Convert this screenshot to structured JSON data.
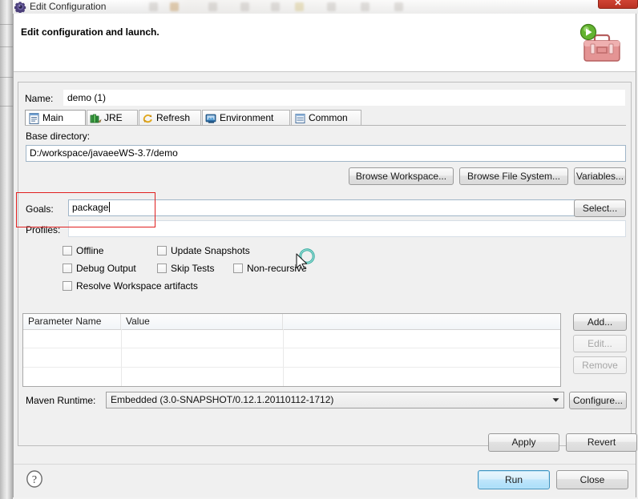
{
  "window": {
    "title": "Edit Configuration",
    "title_icon": "gear-icon",
    "close_label": "✕"
  },
  "header": {
    "title": "Edit configuration and launch.",
    "icon": "maven-launch-toolbox-icon"
  },
  "form": {
    "name_label": "Name:",
    "name_value": "demo (1)"
  },
  "tabs": [
    {
      "label": "Main",
      "icon": "document-icon",
      "selected": true
    },
    {
      "label": "JRE",
      "icon": "books-icon",
      "selected": false
    },
    {
      "label": "Refresh",
      "icon": "refresh-icon",
      "selected": false
    },
    {
      "label": "Environment",
      "icon": "environment-icon",
      "selected": false
    },
    {
      "label": "Common",
      "icon": "common-list-icon",
      "selected": false
    }
  ],
  "main_tab": {
    "base_directory_label": "Base directory:",
    "base_directory_value": "D:/workspace/javaeeWS-3.7/demo",
    "browse_workspace_label": "Browse Workspace...",
    "browse_filesystem_label": "Browse File System...",
    "variables_label": "Variables...",
    "goals_label": "Goals:",
    "goals_value": "package",
    "goals_select_label": "Select...",
    "profiles_label": "Profiles:",
    "profiles_value": "",
    "checkboxes": [
      {
        "label": "Offline",
        "checked": false
      },
      {
        "label": "Update Snapshots",
        "checked": false
      },
      {
        "label": "Debug Output",
        "checked": false
      },
      {
        "label": "Skip Tests",
        "checked": false
      },
      {
        "label": "Non-recursive",
        "checked": false
      },
      {
        "label": "Resolve Workspace artifacts",
        "checked": false
      }
    ],
    "table": {
      "columns": [
        "Parameter Name",
        "Value"
      ],
      "rows": [],
      "empty_row_count": 3
    },
    "table_buttons": [
      {
        "label": "Add...",
        "enabled": true
      },
      {
        "label": "Edit...",
        "enabled": false
      },
      {
        "label": "Remove",
        "enabled": false
      }
    ],
    "maven_runtime_label": "Maven Runtime:",
    "maven_runtime_value": "Embedded (3.0-SNAPSHOT/0.12.1.20110112-1712)",
    "configure_label": "Configure..."
  },
  "actions": {
    "apply_label": "Apply",
    "revert_label": "Revert"
  },
  "footer": {
    "help_icon": "question-mark-icon",
    "run_label": "Run",
    "close_label": "Close"
  },
  "annotation": {
    "highlight_color": "#e01f1f",
    "target": "goals-field"
  },
  "cursor": {
    "type": "busy-pointer-cursor"
  }
}
